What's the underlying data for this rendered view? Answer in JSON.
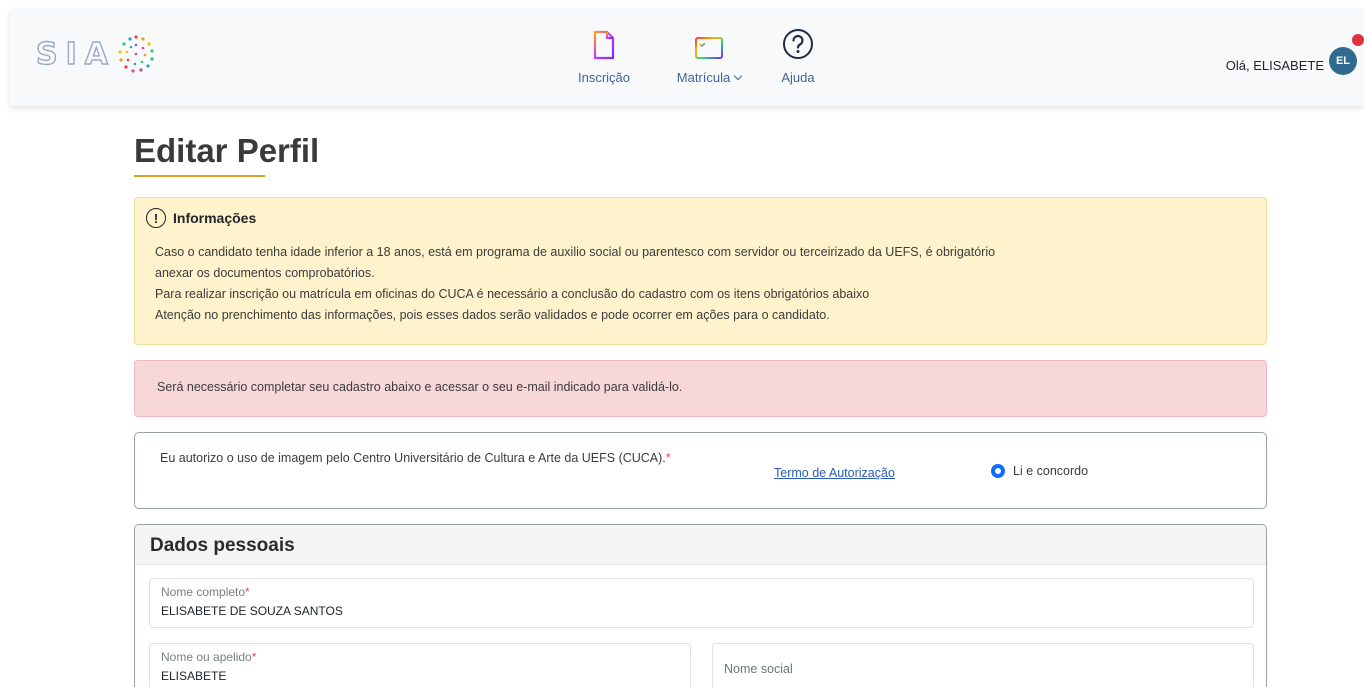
{
  "header": {
    "logo_text": "SIAC",
    "nav": [
      {
        "label": "Inscrição",
        "icon": "document-icon"
      },
      {
        "label": "Matrícula",
        "icon": "checklist-icon",
        "has_dropdown": true
      },
      {
        "label": "Ajuda",
        "icon": "help-icon"
      }
    ],
    "greeting": "Olá, ELISABETE",
    "avatar_initials": "EL"
  },
  "page": {
    "title": "Editar Perfil"
  },
  "info": {
    "title": "Informações",
    "lines": [
      "Caso o candidato tenha idade inferior a 18 anos, está em programa de auxilio social ou parentesco com servidor ou terceirizado da UEFS, é obrigatório",
      "anexar os documentos comprobatórios.",
      "Para realizar inscrição ou matrícula em oficinas do CUCA é necessário a conclusão do cadastro com os itens obrigatórios abaixo",
      "Atenção no prenchimento das informações, pois esses dados serão validados e pode ocorrer em ações para o candidato."
    ]
  },
  "alert": {
    "text": "Será necessário completar seu cadastro abaixo e acessar o seu e-mail indicado para validá-lo."
  },
  "authorization": {
    "text": "Eu autorizo o uso de imagem pelo Centro Universitário de Cultura e Arte da UEFS (CUCA).",
    "required_mark": "*",
    "link": "Termo de Autorização",
    "radio_label": "Li e concordo",
    "radio_checked": true
  },
  "personal": {
    "title": "Dados pessoais",
    "full_name": {
      "label": "Nome completo",
      "required_mark": "*",
      "value": "ELISABETE DE SOUZA SANTOS"
    },
    "nickname": {
      "label": "Nome ou apelido",
      "required_mark": "*",
      "value": "ELISABETE"
    },
    "social_name": {
      "placeholder": "Nome social",
      "value": ""
    }
  },
  "colors": {
    "accent_underline": "#d9a02b",
    "info_bg": "#fff3cd",
    "alert_bg": "#f8d7da",
    "avatar_bg": "#2f6a8f",
    "nav_text": "#41639a",
    "radio": "#0d6efd"
  }
}
